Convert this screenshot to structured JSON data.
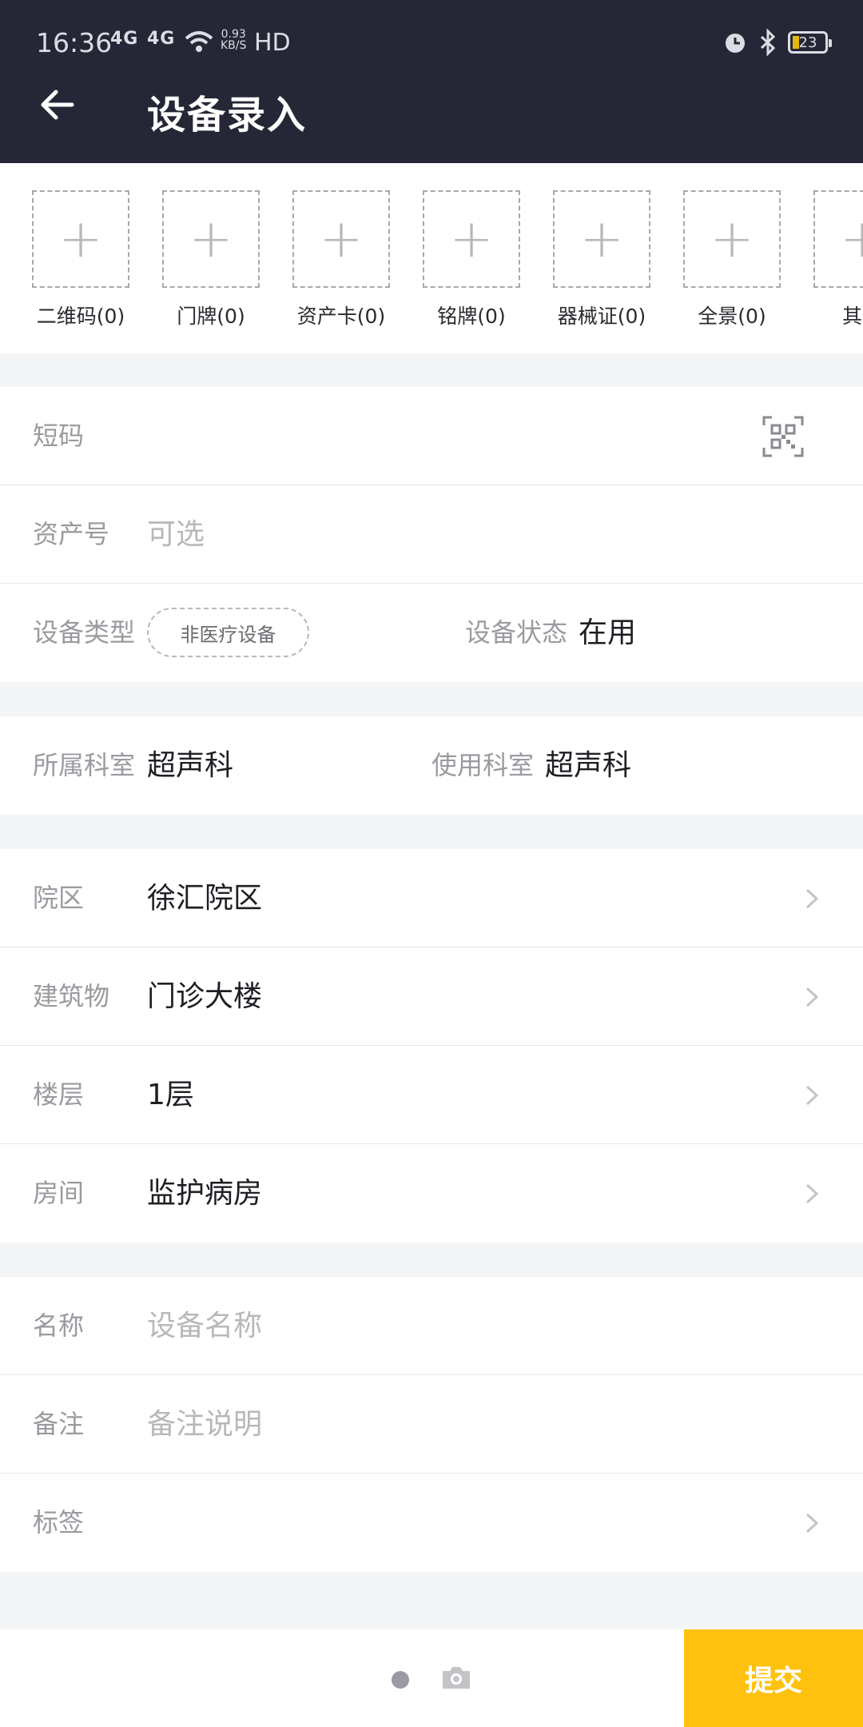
{
  "status_bar": {
    "time": "16:36",
    "signal1": "4G",
    "signal2": "4G",
    "net_speed_value": "0.93",
    "net_speed_unit": "KB/S",
    "hd": "HD",
    "battery": "23"
  },
  "header": {
    "title": "设备录入",
    "back_icon": "arrow-left-icon"
  },
  "photos": [
    {
      "label": "二维码(0)"
    },
    {
      "label": "门牌(0)"
    },
    {
      "label": "资产卡(0)"
    },
    {
      "label": "铭牌(0)"
    },
    {
      "label": "器械证(0)"
    },
    {
      "label": "全景(0)"
    },
    {
      "label": "其他"
    }
  ],
  "basic": {
    "short_code_label": "短码",
    "asset_no_label": "资产号",
    "asset_no_placeholder": "可选",
    "device_type_label": "设备类型",
    "device_type_value": "非医疗设备",
    "device_status_label": "设备状态",
    "device_status_value": "在用"
  },
  "department": {
    "owner_label": "所属科室",
    "owner_value": "超声科",
    "user_label": "使用科室",
    "user_value": "超声科"
  },
  "location": {
    "campus_label": "院区",
    "campus_value": "徐汇院区",
    "building_label": "建筑物",
    "building_value": "门诊大楼",
    "floor_label": "楼层",
    "floor_value": "1层",
    "room_label": "房间",
    "room_value": "监护病房"
  },
  "details": {
    "name_label": "名称",
    "name_placeholder": "设备名称",
    "note_label": "备注",
    "note_placeholder": "备注说明",
    "tag_label": "标签"
  },
  "footer": {
    "submit_label": "提交"
  },
  "colors": {
    "header_bg": "#262736",
    "accent": "#fec10d",
    "page_bg": "#f4f5f7"
  }
}
